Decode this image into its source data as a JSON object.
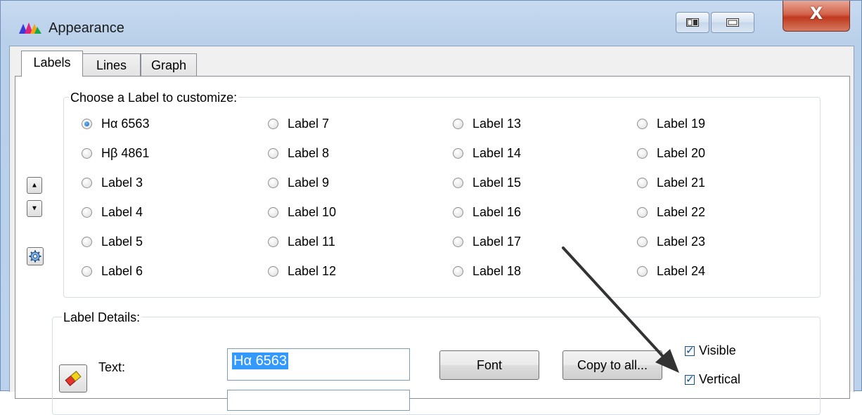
{
  "window": {
    "title": "Appearance",
    "icon": "spectrum-app-icon",
    "close_label": "X"
  },
  "tabs": [
    {
      "label": "Labels",
      "active": true
    },
    {
      "label": "Lines",
      "active": false
    },
    {
      "label": "Graph",
      "active": false
    }
  ],
  "choose_group": {
    "title": "Choose a Label to customize:",
    "columns": [
      [
        "Hα 6563",
        "Hβ 4861",
        "Label 3",
        "Label 4",
        "Label 5",
        "Label 6"
      ],
      [
        "Label 7",
        "Label 8",
        "Label 9",
        "Label 10",
        "Label 11",
        "Label 12"
      ],
      [
        "Label 13",
        "Label 14",
        "Label 15",
        "Label 16",
        "Label 17",
        "Label 18"
      ],
      [
        "Label 19",
        "Label 20",
        "Label 21",
        "Label 22",
        "Label 23",
        "Label 24"
      ]
    ],
    "selected": "Hα 6563"
  },
  "side_buttons": {
    "up_icon": "arrow-up-icon",
    "down_icon": "arrow-down-icon",
    "settings_icon": "gear-icon"
  },
  "details_group": {
    "title": "Label Details:",
    "text_label": "Text:",
    "text_value": "Hα 6563",
    "font_button": "Font",
    "copy_button": "Copy to all...",
    "visible_label": "Visible",
    "visible_checked": true,
    "vertical_label": "Vertical",
    "vertical_checked": true,
    "eraser_icon": "eraser-icon"
  },
  "colors": {
    "frame": "#bcd2ec",
    "close_red": "#c0391f",
    "selection": "#3399ff"
  }
}
